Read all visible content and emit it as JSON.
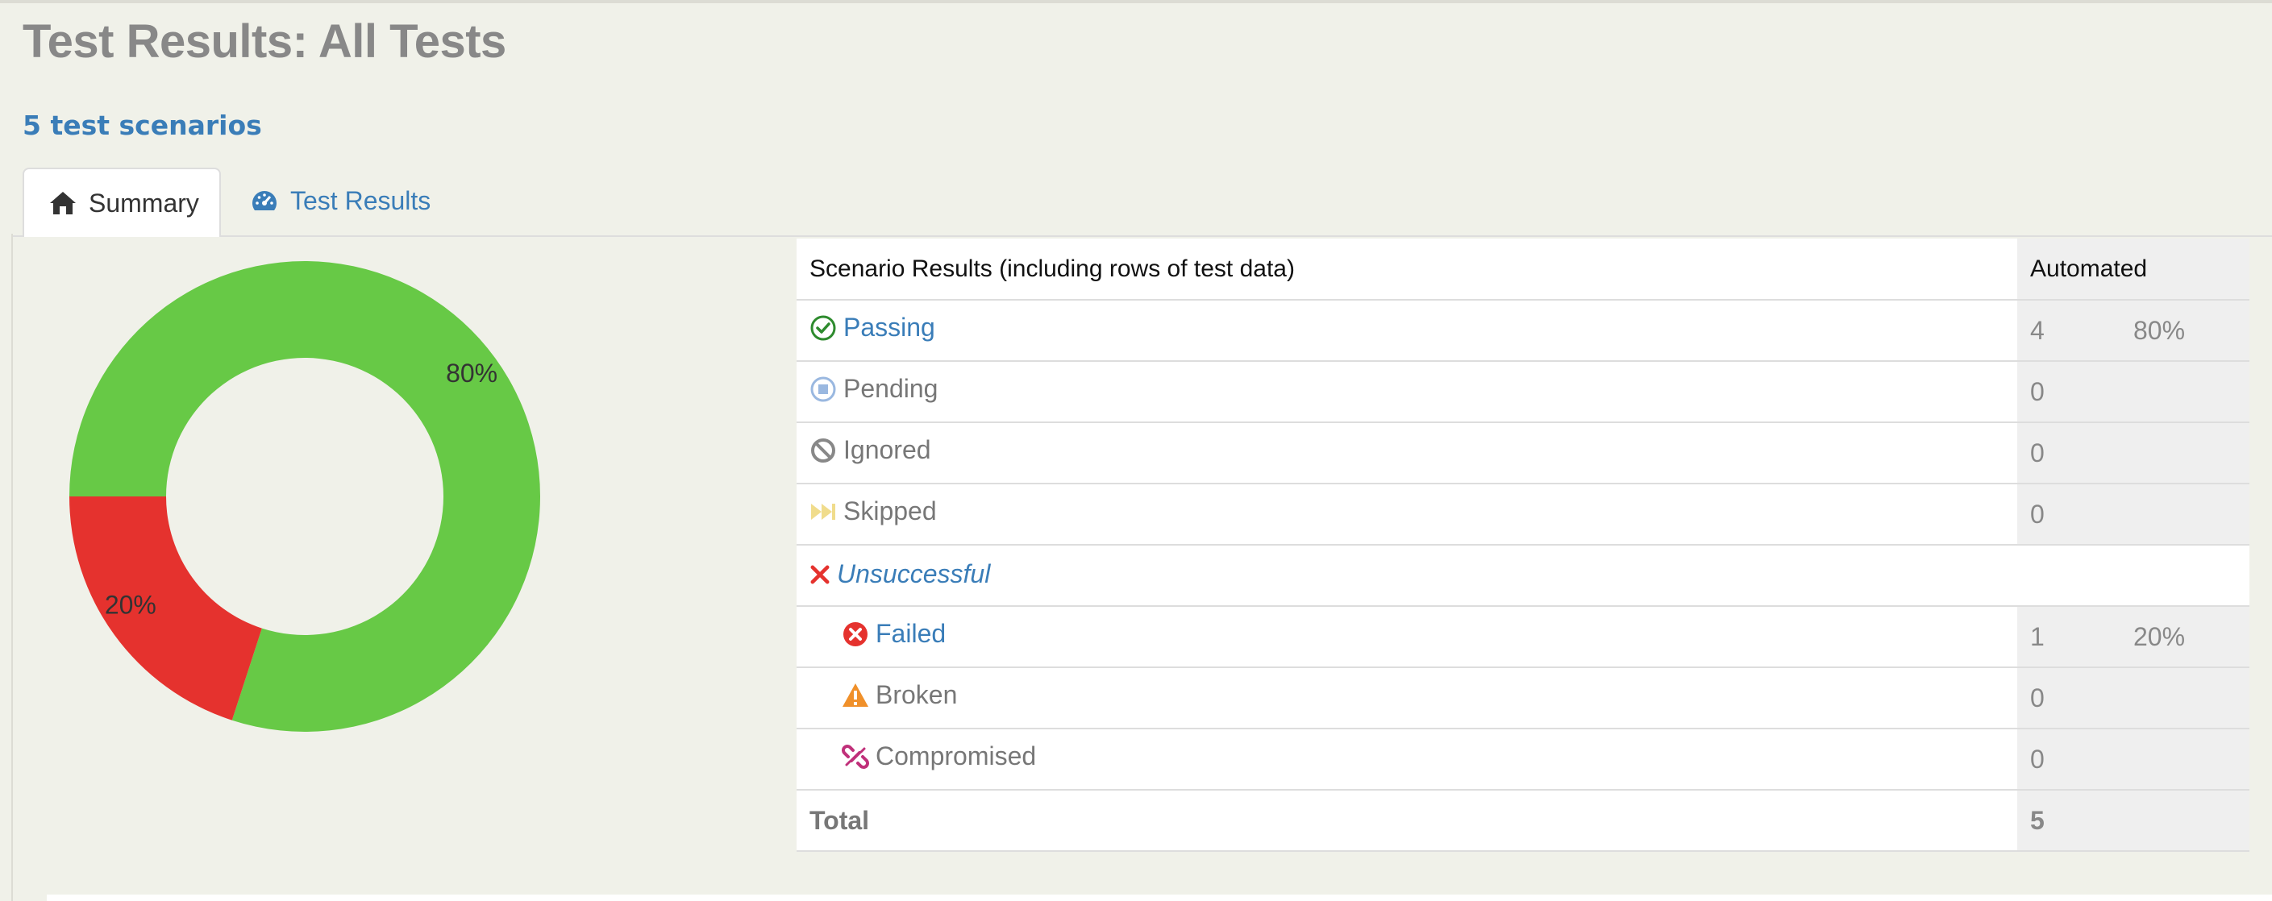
{
  "page": {
    "title": "Test Results: All Tests",
    "scenario_count": "5 test scenarios"
  },
  "tabs": [
    {
      "label": "Summary",
      "icon": "home-icon",
      "active": true
    },
    {
      "label": "Test Results",
      "icon": "dashboard-gauge-icon",
      "active": false
    }
  ],
  "chart_data": {
    "type": "pie",
    "donut": true,
    "slices": [
      {
        "label": "80%",
        "value": 80,
        "color": "#67c946"
      },
      {
        "label": "20%",
        "value": 20,
        "color": "#e5322e"
      }
    ]
  },
  "table": {
    "header": {
      "label": "Scenario Results (including rows of test data)",
      "automated": "Automated"
    },
    "rows": [
      {
        "label": "Passing",
        "count": "4",
        "pct": "80%",
        "icon": "check-circle-icon",
        "color": "#2e8b2e"
      },
      {
        "label": "Pending",
        "count": "0",
        "pct": "",
        "icon": "stop-circle-icon",
        "color": "#9ab8e0"
      },
      {
        "label": "Ignored",
        "count": "0",
        "pct": "",
        "icon": "ban-icon",
        "color": "#888888"
      },
      {
        "label": "Skipped",
        "count": "0",
        "pct": "",
        "icon": "fast-forward-icon",
        "color": "#f0dc8c"
      },
      {
        "label": "Unsuccessful",
        "count": "",
        "pct": "",
        "icon": "x-icon",
        "color": "#e5322e"
      },
      {
        "label": "Failed",
        "count": "1",
        "pct": "20%",
        "icon": "x-circle-icon",
        "color": "#e5322e"
      },
      {
        "label": "Broken",
        "count": "0",
        "pct": "",
        "icon": "warning-triangle-icon",
        "color": "#f0902a"
      },
      {
        "label": "Compromised",
        "count": "0",
        "pct": "",
        "icon": "broken-link-icon",
        "color": "#c0307a"
      }
    ],
    "total": {
      "label": "Total",
      "count": "5"
    }
  }
}
